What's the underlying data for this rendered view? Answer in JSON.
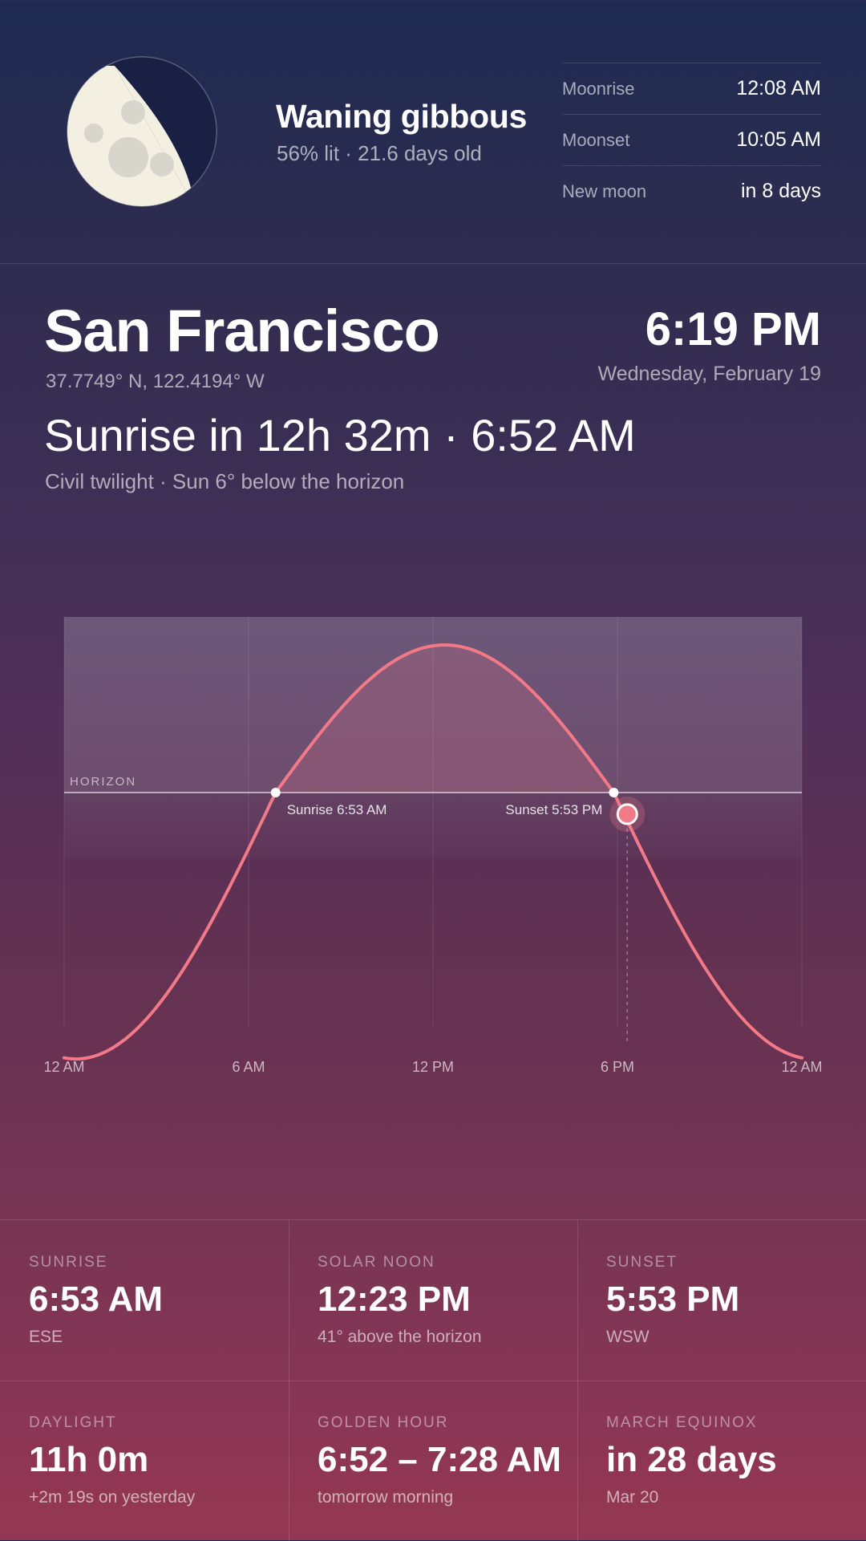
{
  "moon": {
    "phase": "Waning gibbous",
    "detail": "56% lit · 21.6 days old",
    "illumination": 0.56,
    "rows": [
      {
        "label": "Moonrise",
        "value": "12:08 AM"
      },
      {
        "label": "Moonset",
        "value": "10:05 AM"
      },
      {
        "label": "New moon",
        "value": "in 8 days"
      }
    ]
  },
  "location": {
    "city": "San Francisco",
    "coords": "37.7749° N, 122.4194° W",
    "time": "6:19 PM",
    "date": "Wednesday, February 19"
  },
  "status": {
    "headline": "Sunrise in 12h 32m · 6:52 AM",
    "subline": "Civil twilight · Sun 6° below the horizon"
  },
  "chart_data": {
    "type": "line",
    "horizon_label": "HORIZON",
    "x_ticks": [
      "12 AM",
      "6 AM",
      "12 PM",
      "6 PM",
      "12 AM"
    ],
    "annotations": [
      {
        "label": "Sunrise 6:53 AM",
        "hour": 6.88
      },
      {
        "label": "Sunset 5:53 PM",
        "hour": 17.88
      }
    ],
    "current": {
      "hour": 18.32,
      "altitude_deg": -6
    },
    "solar_noon": {
      "hour": 12.38,
      "altitude_deg": 41
    },
    "nadir_altitude_deg": -74,
    "colors": {
      "curve": "#f27a88",
      "marker": "#f27a88"
    }
  },
  "stats": [
    {
      "key": "SUNRISE",
      "value": "6:53 AM",
      "sub": "ESE"
    },
    {
      "key": "SOLAR NOON",
      "value": "12:23 PM",
      "sub": "41° above the horizon"
    },
    {
      "key": "SUNSET",
      "value": "5:53 PM",
      "sub": "WSW"
    },
    {
      "key": "DAYLIGHT",
      "value": "11h 0m",
      "sub": "+2m 19s on yesterday"
    },
    {
      "key": "GOLDEN HOUR",
      "value": "6:52 – 7:28 AM",
      "sub": "tomorrow morning"
    },
    {
      "key": "MARCH EQUINOX",
      "value": "in 28 days",
      "sub": "Mar 20"
    }
  ]
}
